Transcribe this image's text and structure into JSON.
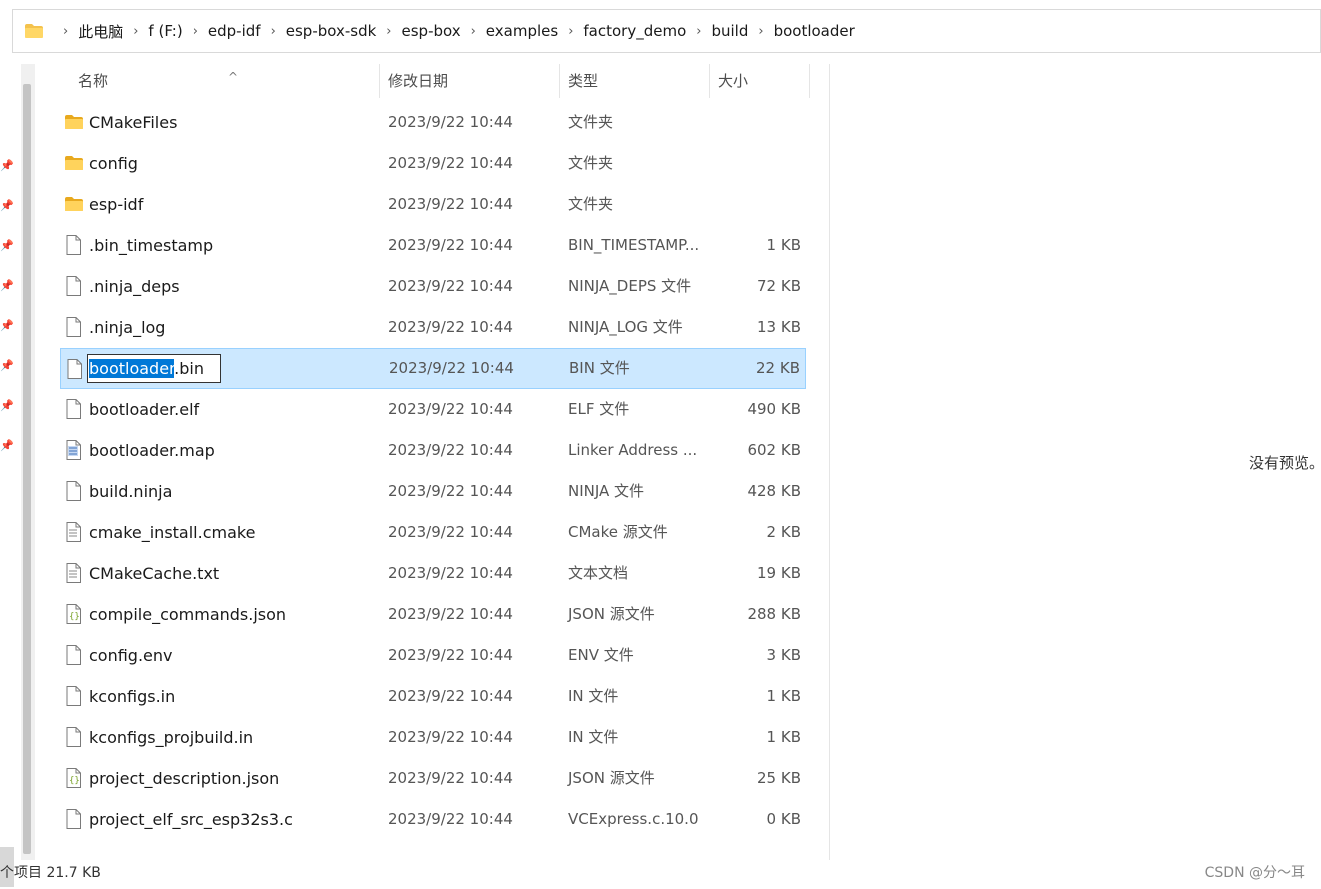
{
  "breadcrumb": [
    "此电脑",
    "f (F:)",
    "edp-idf",
    "esp-box-sdk",
    "esp-box",
    "examples",
    "factory_demo",
    "build",
    "bootloader"
  ],
  "columns": {
    "name": "名称",
    "modified": "修改日期",
    "type": "类型",
    "size": "大小"
  },
  "files": [
    {
      "name": "CMakeFiles",
      "date": "2023/9/22 10:44",
      "type": "文件夹",
      "size": "",
      "icon": "folder"
    },
    {
      "name": "config",
      "date": "2023/9/22 10:44",
      "type": "文件夹",
      "size": "",
      "icon": "folder"
    },
    {
      "name": "esp-idf",
      "date": "2023/9/22 10:44",
      "type": "文件夹",
      "size": "",
      "icon": "folder"
    },
    {
      "name": ".bin_timestamp",
      "date": "2023/9/22 10:44",
      "type": "BIN_TIMESTAMP...",
      "size": "1 KB",
      "icon": "file"
    },
    {
      "name": ".ninja_deps",
      "date": "2023/9/22 10:44",
      "type": "NINJA_DEPS 文件",
      "size": "72 KB",
      "icon": "file"
    },
    {
      "name": ".ninja_log",
      "date": "2023/9/22 10:44",
      "type": "NINJA_LOG 文件",
      "size": "13 KB",
      "icon": "file"
    },
    {
      "name": "bootloader.bin",
      "date": "2023/9/22 10:44",
      "type": "BIN 文件",
      "size": "22 KB",
      "icon": "file",
      "selected": true,
      "rename_selected": "bootloader",
      "rename_rest": ".bin"
    },
    {
      "name": "bootloader.elf",
      "date": "2023/9/22 10:44",
      "type": "ELF 文件",
      "size": "490 KB",
      "icon": "file"
    },
    {
      "name": "bootloader.map",
      "date": "2023/9/22 10:44",
      "type": "Linker Address ...",
      "size": "602 KB",
      "icon": "map"
    },
    {
      "name": "build.ninja",
      "date": "2023/9/22 10:44",
      "type": "NINJA 文件",
      "size": "428 KB",
      "icon": "file"
    },
    {
      "name": "cmake_install.cmake",
      "date": "2023/9/22 10:44",
      "type": "CMake 源文件",
      "size": "2 KB",
      "icon": "text"
    },
    {
      "name": "CMakeCache.txt",
      "date": "2023/9/22 10:44",
      "type": "文本文档",
      "size": "19 KB",
      "icon": "text"
    },
    {
      "name": "compile_commands.json",
      "date": "2023/9/22 10:44",
      "type": "JSON 源文件",
      "size": "288 KB",
      "icon": "json"
    },
    {
      "name": "config.env",
      "date": "2023/9/22 10:44",
      "type": "ENV 文件",
      "size": "3 KB",
      "icon": "file"
    },
    {
      "name": "kconfigs.in",
      "date": "2023/9/22 10:44",
      "type": "IN 文件",
      "size": "1 KB",
      "icon": "file"
    },
    {
      "name": "kconfigs_projbuild.in",
      "date": "2023/9/22 10:44",
      "type": "IN 文件",
      "size": "1 KB",
      "icon": "file"
    },
    {
      "name": "project_description.json",
      "date": "2023/9/22 10:44",
      "type": "JSON 源文件",
      "size": "25 KB",
      "icon": "json"
    },
    {
      "name": "project_elf_src_esp32s3.c",
      "date": "2023/9/22 10:44",
      "type": "VCExpress.c.10.0",
      "size": "0 KB",
      "icon": "file"
    }
  ],
  "preview": {
    "text": "没有预览。"
  },
  "status": {
    "text": "个项目   21.7 KB"
  },
  "watermark": "CSDN @分～耳",
  "colors": {
    "selection_bg": "#cce8ff",
    "selection_border": "#99d1ff",
    "rename_highlight": "#0078d7",
    "folder": "#f4c24d"
  }
}
